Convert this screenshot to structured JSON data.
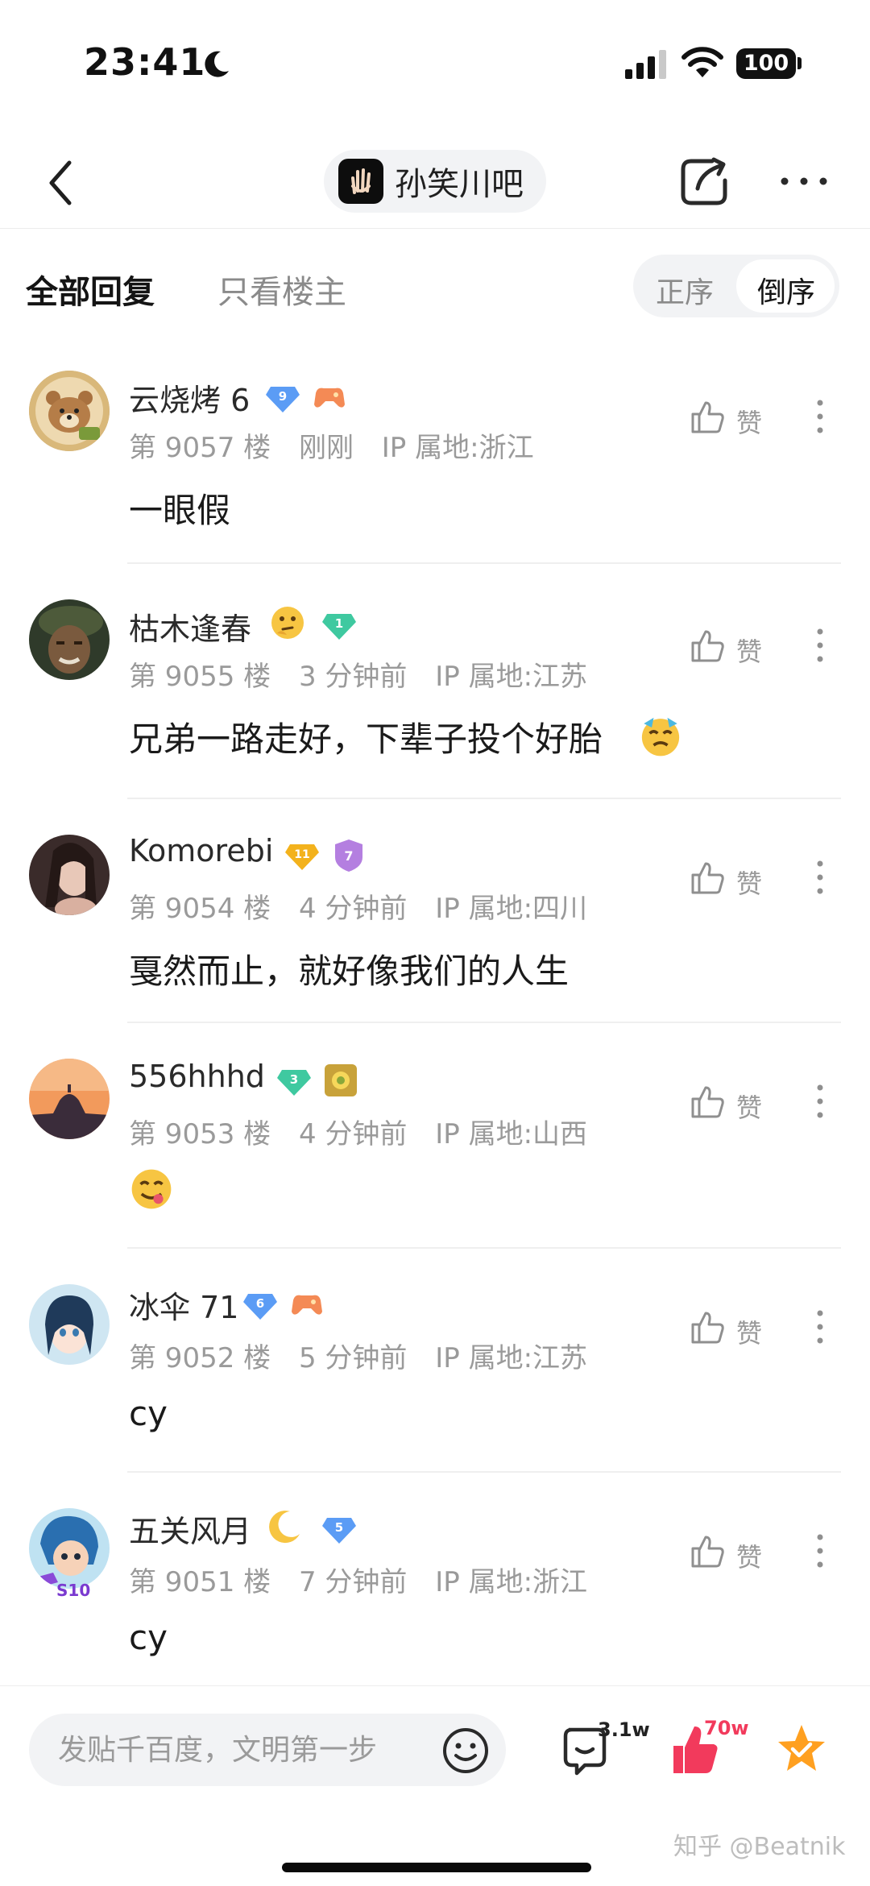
{
  "status_bar": {
    "time": "23:41",
    "battery": "100"
  },
  "nav": {
    "forum_name": "孙笑川吧"
  },
  "filters": {
    "all_replies": "全部回复",
    "owner_only": "只看楼主",
    "order_asc": "正序",
    "order_desc": "倒序"
  },
  "comments": [
    {
      "username": "云烧烤 6",
      "badges": [
        "9",
        ""
      ],
      "floor": "第 9057 楼",
      "time": "刚刚",
      "ip": "IP 属地:浙江",
      "content": "一眼假",
      "like_label": "赞"
    },
    {
      "username": "枯木逢春",
      "badges": [
        "",
        "1"
      ],
      "floor": "第 9055 楼",
      "time": "3 分钟前",
      "ip": "IP 属地:江苏",
      "content": "兄弟一路走好，下辈子投个好胎",
      "like_label": "赞"
    },
    {
      "username": "Komorebi",
      "badges": [
        "11",
        "7"
      ],
      "floor": "第 9054 楼",
      "time": "4 分钟前",
      "ip": "IP 属地:四川",
      "content": "戛然而止，就好像我们的人生",
      "like_label": "赞"
    },
    {
      "username": "556hhhd",
      "badges": [
        "3",
        ""
      ],
      "floor": "第 9053 楼",
      "time": "4 分钟前",
      "ip": "IP 属地:山西",
      "content": "",
      "like_label": "赞"
    },
    {
      "username": "冰伞 71",
      "badges": [
        "6",
        ""
      ],
      "floor": "第 9052 楼",
      "time": "5 分钟前",
      "ip": "IP 属地:江苏",
      "content": "cy",
      "like_label": "赞"
    },
    {
      "username": "五关风月",
      "badges": [
        "",
        "5"
      ],
      "floor": "第 9051 楼",
      "time": "7 分钟前",
      "ip": "IP 属地:浙江",
      "content": "cy",
      "like_label": "赞",
      "avatar_tag": "S10"
    }
  ],
  "bottom_bar": {
    "input_placeholder": "发贴千百度，文明第一步",
    "comment_count": "3.1w",
    "like_count": "70w",
    "watermark": "知乎 @Beatnik"
  },
  "colors": {
    "accent_red": "#f23a5c",
    "star_orange": "#ffa020",
    "diamond_blue": "#5b9cf5",
    "diamond_green": "#3fc9a0"
  }
}
